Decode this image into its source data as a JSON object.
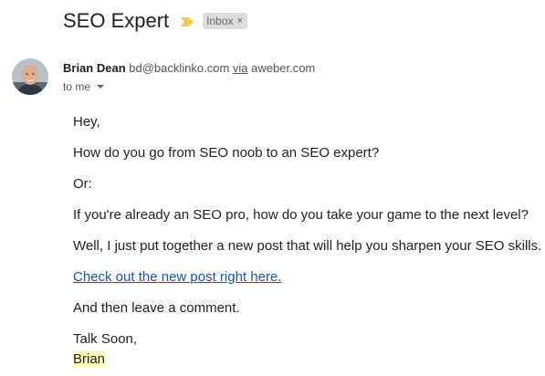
{
  "email": {
    "subject": "SEO Expert",
    "label": "Inbox",
    "label_close": "×",
    "sender": {
      "name": "Brian Dean",
      "email": "bd@backlinko.com",
      "via_word": "via",
      "via_domain": "aweber.com"
    },
    "recipient": "to me",
    "body": {
      "greeting": "Hey,",
      "question": "How do you go from SEO noob to an SEO expert?",
      "or": "Or:",
      "pro_question": "If you're already an SEO pro, how do you take your game to the next level?",
      "post_intro": "Well, I just put together a new post that will help you sharpen your SEO skills.",
      "link_text": "Check out the new post right here.",
      "comment_request": "And then leave a comment.",
      "signoff": "Talk Soon,",
      "signature": "Brian"
    }
  },
  "icons": {
    "importance": "importance-marker-icon",
    "avatar": "avatar",
    "caret": "chevron-down-icon"
  },
  "colors": {
    "importance": "#f2c94c",
    "label_bg": "#dddddd",
    "link": "#1155cc",
    "highlight": "#ffffb3"
  }
}
